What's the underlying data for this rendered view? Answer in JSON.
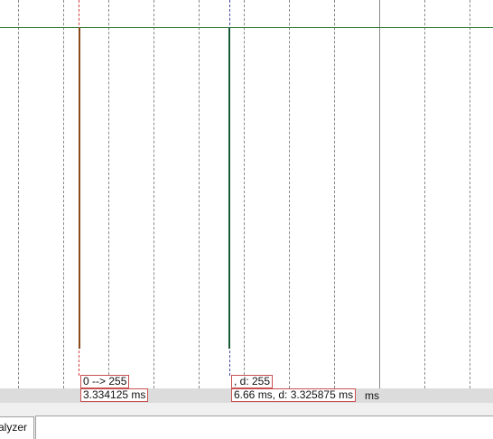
{
  "cursor_a": {
    "value_label": "0 --> 255",
    "time_label": "3.334125 ms"
  },
  "cursor_b": {
    "value_label": ",  d: 255",
    "time_label": "6.66 ms,  d: 3.325875 ms"
  },
  "time_axis": {
    "unit": "ms"
  },
  "bottom_tab": {
    "label": "alyzer"
  },
  "colors": {
    "grid": "#8a8a8a",
    "signal_trace": "#2f7a2f",
    "cursor_a": "#d84040",
    "cursor_b": "#4848a0",
    "label_border": "#c85050",
    "axis_background": "#dcdcdc"
  }
}
